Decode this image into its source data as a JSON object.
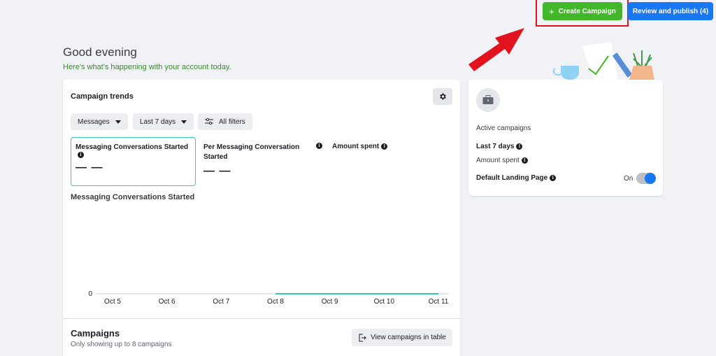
{
  "topbar": {
    "create_label": "Create Campaign",
    "review_label": "Review and publish (4)"
  },
  "greeting": {
    "title": "Good evening",
    "subtitle": "Here's what's happening with your account today."
  },
  "trends": {
    "title": "Campaign trends",
    "filters": {
      "messages": "Messages",
      "range": "Last 7 days",
      "all": "All filters"
    },
    "metrics": [
      {
        "label": "Messaging Conversations Started",
        "value": "— —"
      },
      {
        "label": "Per Messaging Conversation Started",
        "value": "— —"
      },
      {
        "label": "Amount spent",
        "value": ""
      }
    ],
    "chart_title": "Messaging Conversations Started"
  },
  "chart_data": {
    "type": "line",
    "categories": [
      "Oct 5",
      "Oct 6",
      "Oct 7",
      "Oct 8",
      "Oct 9",
      "Oct 10",
      "Oct 11"
    ],
    "series": [
      {
        "values": [
          null,
          null,
          null,
          0,
          0,
          0,
          0
        ]
      }
    ],
    "y_ticks": [
      "0"
    ],
    "ylim": [
      0,
      1
    ],
    "line_color": "#38c1c6"
  },
  "campaigns": {
    "title": "Campaigns",
    "subtitle": "Only showing up to 8 campaigns",
    "view_label": "View campaigns in table"
  },
  "side": {
    "active_label": "Active campaigns",
    "range_label": "Last 7 days",
    "amount_label": "Amount spent",
    "landing_label": "Default Landing Page",
    "toggle_label": "On"
  }
}
